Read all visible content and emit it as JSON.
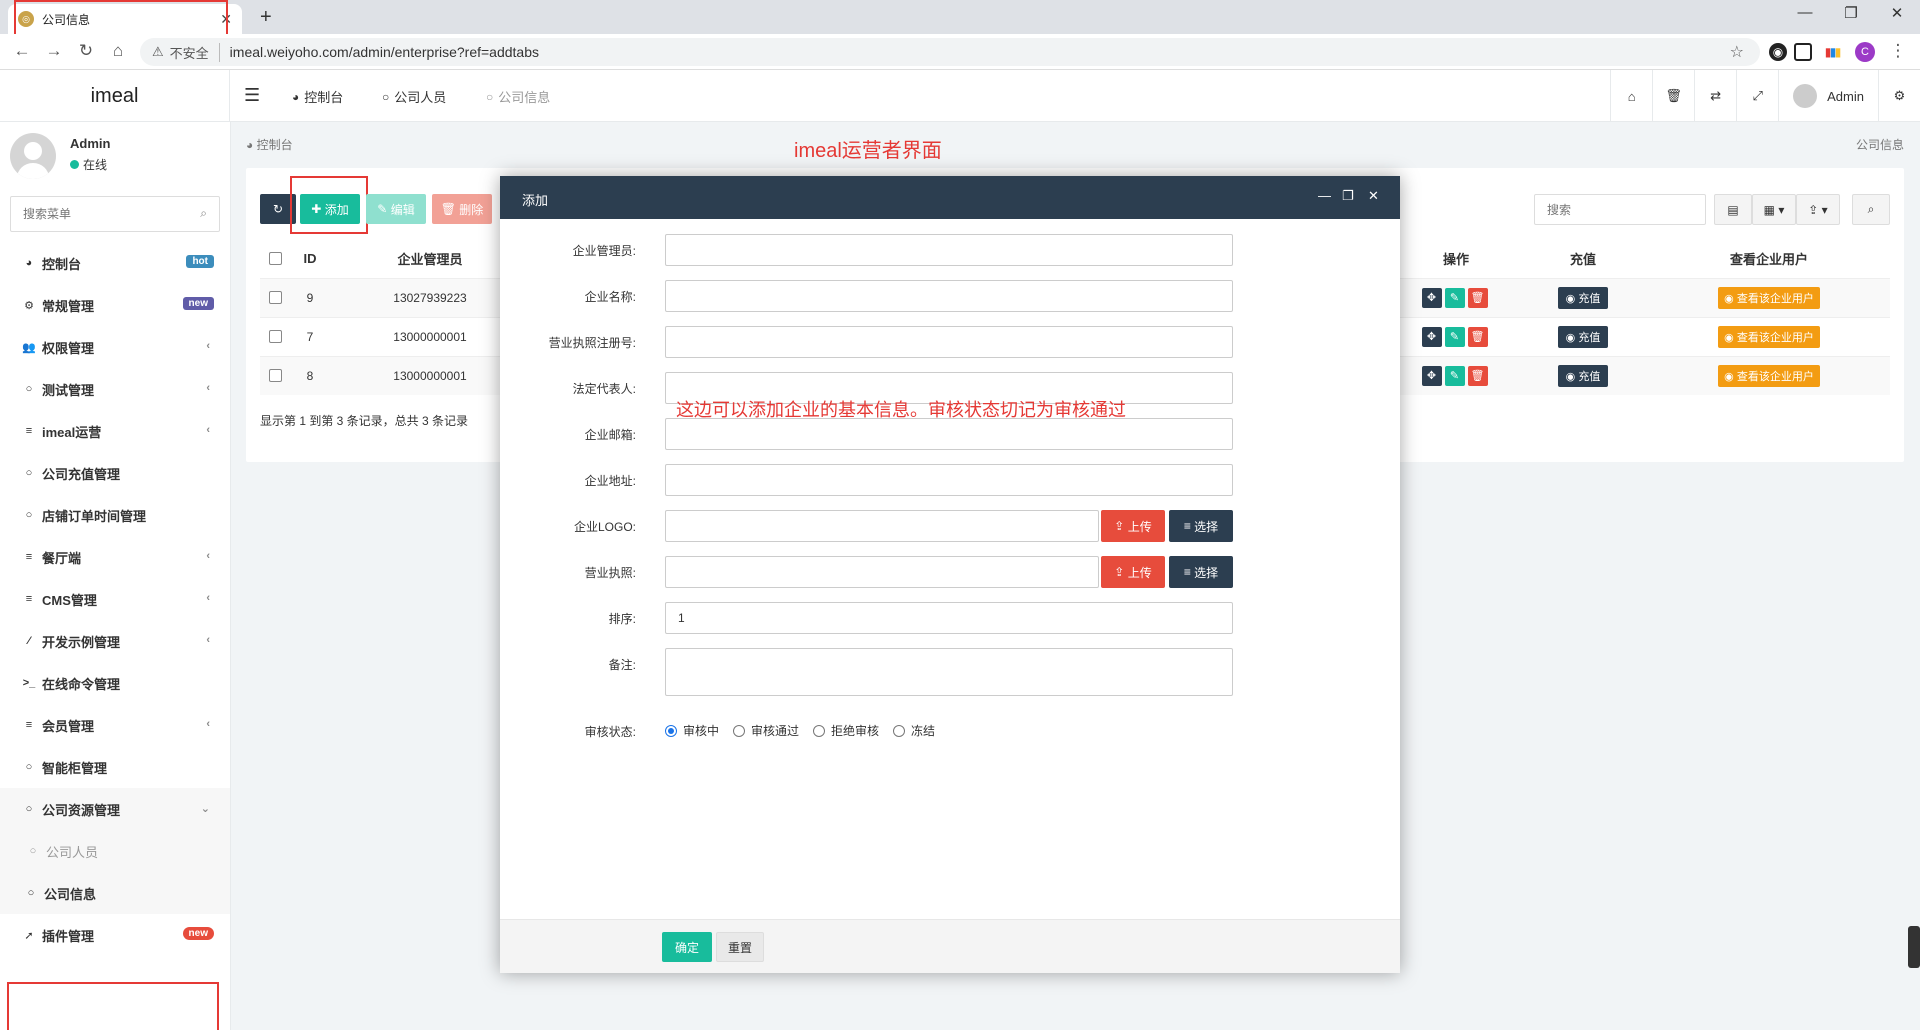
{
  "browser": {
    "tab_title": "公司信息",
    "new_tab": "+",
    "insecure_label": "不安全",
    "url": "imeal.weiyoho.com/admin/enterprise?ref=addtabs",
    "profile_initial": "C"
  },
  "header": {
    "logo": "imeal",
    "tabs": [
      {
        "label": "控制台",
        "icon": "dashboard-icon"
      },
      {
        "label": "公司人员",
        "icon": "circle-icon"
      },
      {
        "label": "公司信息",
        "icon": "circle-icon"
      }
    ],
    "user": "Admin"
  },
  "sidebar": {
    "user_name": "Admin",
    "user_status": "在线",
    "search_placeholder": "搜索菜单",
    "items": [
      {
        "label": "控制台",
        "badge": "hot",
        "badge_color": "#3c8dbc"
      },
      {
        "label": "常规管理",
        "badge": "new",
        "badge_color": "#605ca8"
      },
      {
        "label": "权限管理"
      },
      {
        "label": "测试管理"
      },
      {
        "label": "imeal运营"
      },
      {
        "label": "公司充值管理"
      },
      {
        "label": "店铺订单时间管理"
      },
      {
        "label": "餐厅端"
      },
      {
        "label": "CMS管理"
      },
      {
        "label": "开发示例管理"
      },
      {
        "label": "在线命令管理"
      },
      {
        "label": "会员管理"
      },
      {
        "label": "智能柜管理"
      },
      {
        "label": "公司资源管理"
      },
      {
        "label": "公司人员"
      },
      {
        "label": "公司信息"
      },
      {
        "label": "插件管理",
        "badge": "new",
        "badge_color": "#e74c3c"
      }
    ]
  },
  "content": {
    "breadcrumb": "控制台",
    "breadcrumb_right": "公司信息",
    "overlay_title": "imeal运营者界面",
    "toolbar": {
      "add": "添加",
      "edit": "编辑",
      "delete": "删除",
      "search_placeholder": "搜索"
    },
    "table": {
      "headers": [
        "ID",
        "企业管理员",
        "操作",
        "充值",
        "查看企业用户"
      ],
      "rows": [
        {
          "id": "9",
          "admin": "13027939223"
        },
        {
          "id": "7",
          "admin": "13000000001"
        },
        {
          "id": "8",
          "admin": "13000000001"
        }
      ],
      "recharge_label": "充值",
      "view_label": "查看该企业用户",
      "pager": "显示第 1 到第 3 条记录，总共 3 条记录"
    }
  },
  "modal": {
    "title": "添加",
    "fields": {
      "admin": "企业管理员:",
      "name": "企业名称:",
      "license_no": "营业执照注册号:",
      "legal_rep": "法定代表人:",
      "email": "企业邮箱:",
      "address": "企业地址:",
      "logo": "企业LOGO:",
      "license": "营业执照:",
      "sort": "排序:",
      "remark": "备注:",
      "status": "审核状态:"
    },
    "sort_value": "1",
    "upload": "上传",
    "choose": "选择",
    "status_options": [
      "审核中",
      "审核通过",
      "拒绝审核",
      "冻结"
    ],
    "status_selected": "审核中",
    "note": "这边可以添加企业的基本信息。审核状态切记为审核通过",
    "ok": "确定",
    "reset": "重置"
  }
}
